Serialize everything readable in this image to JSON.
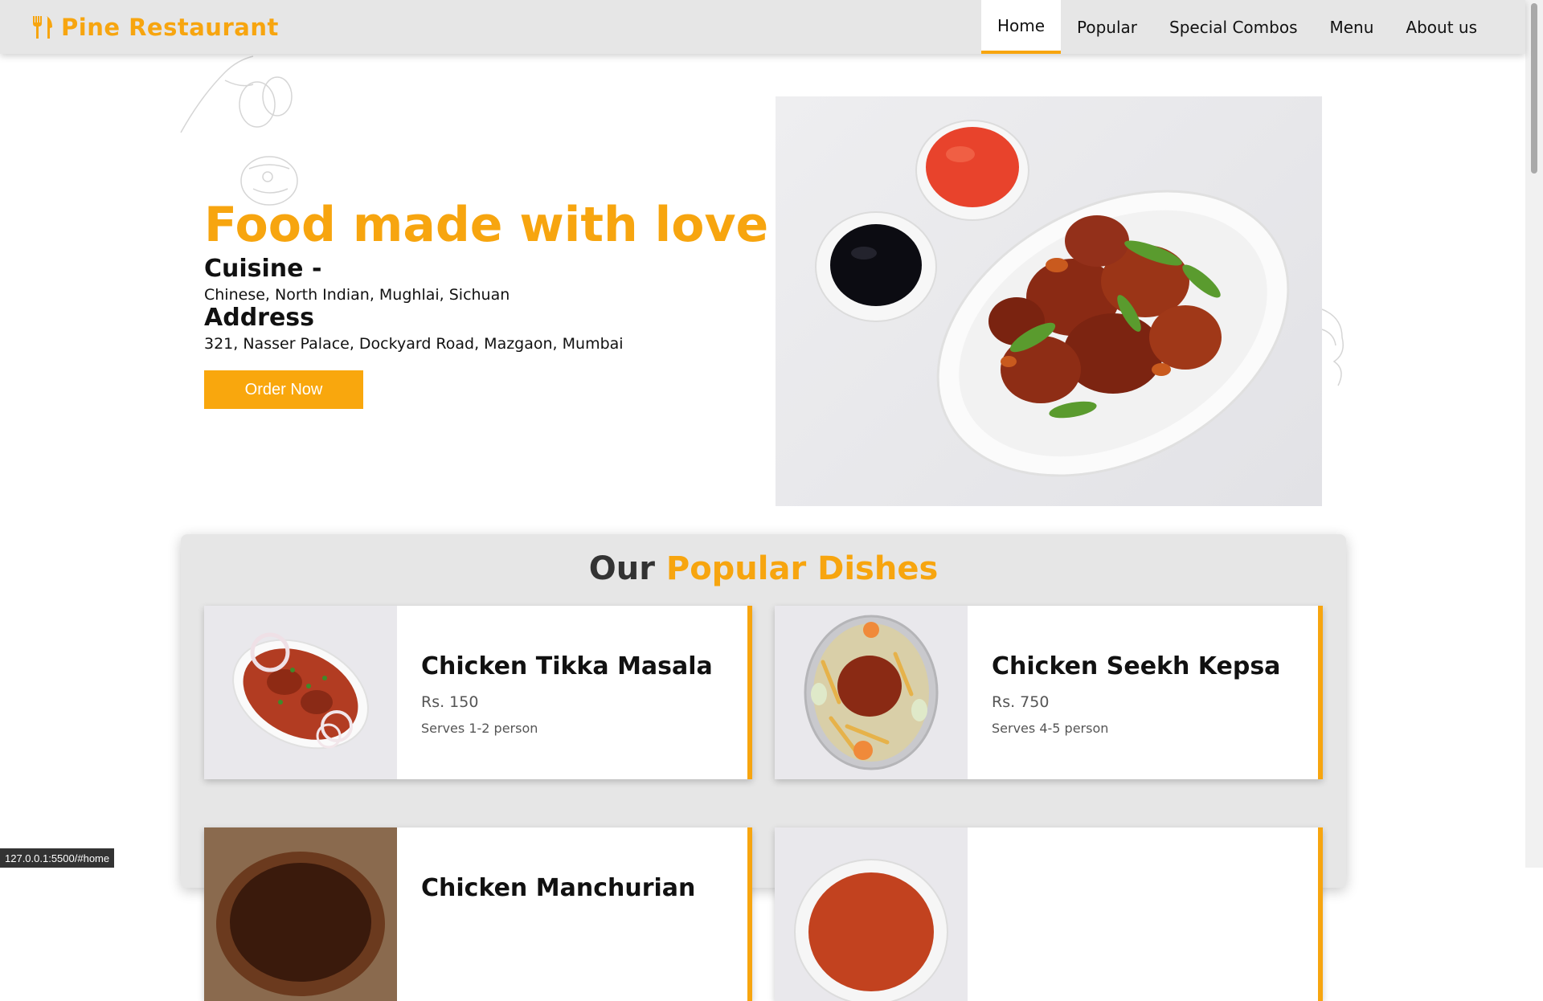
{
  "brand": {
    "name": "Pine Restaurant",
    "icon": "fork-knife-icon",
    "color": "#f7a50f"
  },
  "nav": {
    "items": [
      {
        "label": "Home",
        "active": true
      },
      {
        "label": "Popular",
        "active": false
      },
      {
        "label": "Special Combos",
        "active": false
      },
      {
        "label": "Menu",
        "active": false
      },
      {
        "label": "About us",
        "active": false
      }
    ]
  },
  "hero": {
    "title": "Food made with love",
    "cuisine_heading": "Cuisine -",
    "cuisine_text": "Chinese, North Indian, Mughlai, Sichuan",
    "address_heading": "Address",
    "address_text": "321, Nasser Palace, Dockyard Road, Mazgaon, Mumbai",
    "order_button": "Order Now"
  },
  "popular": {
    "title_dark": "Our",
    "title_accent": "Popular Dishes",
    "dishes": [
      {
        "name": "Chicken Tikka Masala",
        "price": "Rs. 150",
        "serves": "Serves 1-2 person"
      },
      {
        "name": "Chicken Seekh Kepsa",
        "price": "Rs. 750",
        "serves": "Serves 4-5 person"
      },
      {
        "name": "Chicken Manchurian",
        "price": "",
        "serves": ""
      },
      {
        "name": "",
        "price": "",
        "serves": ""
      }
    ]
  },
  "status_url": "127.0.0.1:5500/#home",
  "colors": {
    "accent": "#f7a50f",
    "navbar_bg": "#e6e6e6",
    "section_bg": "#e6e6e6"
  }
}
